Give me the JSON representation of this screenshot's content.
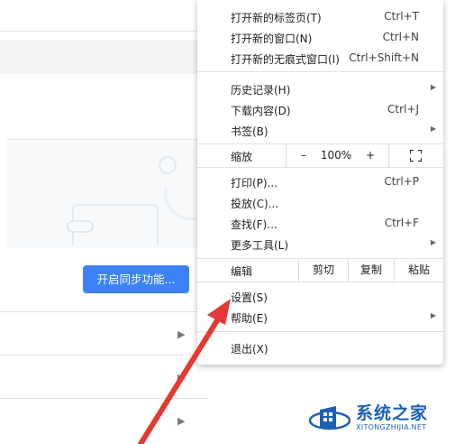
{
  "background": {
    "sync_button_label": "开启同步功能..."
  },
  "menu": {
    "group1": [
      {
        "label": "打开新的标签页(T)",
        "shortcut": "Ctrl+T"
      },
      {
        "label": "打开新的窗口(N)",
        "shortcut": "Ctrl+N"
      },
      {
        "label": "打开新的无痕式窗口(I)",
        "shortcut": "Ctrl+Shift+N"
      }
    ],
    "group2": [
      {
        "label": "历史记录(H)",
        "shortcut": ""
      },
      {
        "label": "下载内容(D)",
        "shortcut": "Ctrl+J"
      },
      {
        "label": "书签(B)",
        "shortcut": ""
      }
    ],
    "zoom": {
      "label": "缩放",
      "minus": "–",
      "value": "100%",
      "plus": "+",
      "fullscreen_icon": "fullscreen-icon"
    },
    "group3": [
      {
        "label": "打印(P)...",
        "shortcut": "Ctrl+P"
      },
      {
        "label": "投放(C)...",
        "shortcut": ""
      },
      {
        "label": "查找(F)...",
        "shortcut": "Ctrl+F"
      },
      {
        "label": "更多工具(L)",
        "shortcut": ""
      }
    ],
    "edit": {
      "label": "编辑",
      "cut": "剪切",
      "copy": "复制",
      "paste": "粘贴"
    },
    "group4": [
      {
        "label": "设置(S)"
      },
      {
        "label": "帮助(E)"
      }
    ],
    "exit_label": "退出(X)"
  },
  "watermark": {
    "title": "系统之家",
    "subtitle": "XITONGZHIJIA.NET"
  },
  "colors": {
    "accent": "#3b82f6",
    "arrow": "#e53935",
    "watermark": "#1d5fb5"
  }
}
